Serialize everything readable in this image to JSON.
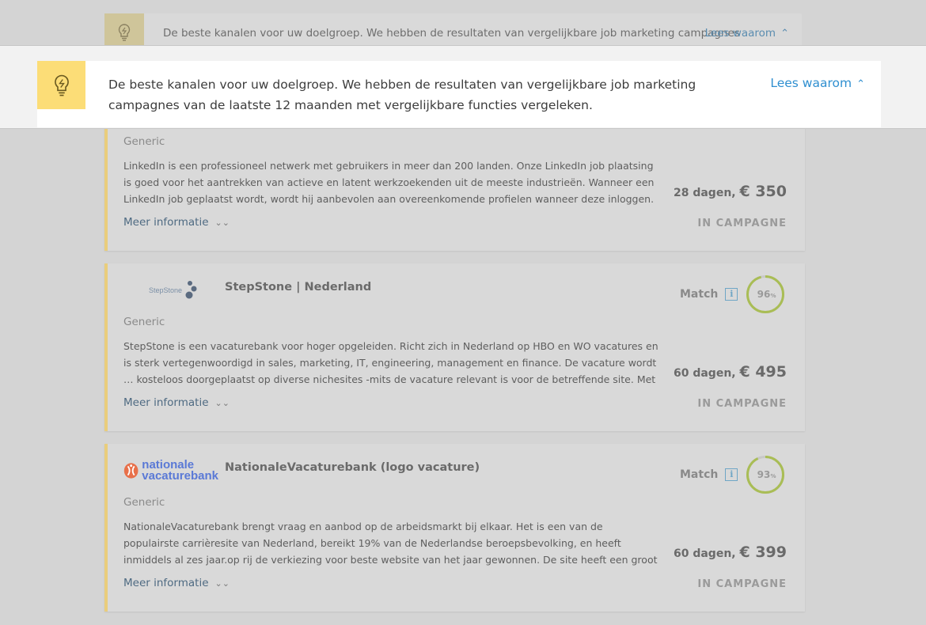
{
  "background_banner": {
    "text": "De beste kanalen voor uw doelgroep. We hebben de resultaten van vergelijkbare job marketing campagnes",
    "link": "Lees waarom"
  },
  "banner": {
    "text": "De beste kanalen voor uw doelgroep. We hebben de resultaten van vergelijkbare job marketing campagnes van de laatste 12 maanden met vergelijkbare functies vergeleken.",
    "link": "Lees waarom",
    "icon": "lightbulb-icon",
    "accent": "#fcdd77",
    "link_color": "#2f8fd0"
  },
  "cards": [
    {
      "category": "Generic",
      "description": "LinkedIn is een professioneel netwerk met gebruikers in meer dan 200 landen. Onze LinkedIn job plaatsing is goed voor het aantrekken van actieve en latent werkzoekenden uit de meeste industrieën. Wanneer een LinkedIn job geplaatst wordt, wordt hij aanbevolen aan overeenkomende profielen wanneer deze inloggen. Oo…",
      "duration": "28 dagen,",
      "price": "€ 350",
      "more": "Meer informatie",
      "status": "IN CAMPAGNE"
    },
    {
      "name": "StepStone | Nederland",
      "logo_text": "StepStone",
      "match_label": "Match",
      "info": "i",
      "match_value": "96",
      "match_unit": "%",
      "match_fraction": 0.96,
      "category": "Generic",
      "description": "StepStone is een vacaturebank voor hoger opgeleiden. Richt zich in Nederland op HBO en WO vacatures en is sterk vertegenwoordigd in sales, marketing, IT, engineering, management en finance. De vacature wordt          … kosteloos doorgeplaatst op diverse nichesites -mits de vacature relevant is voor de betreffende site. Met de",
      "duration": "60 dagen,",
      "price": "€ 495",
      "more": "Meer informatie",
      "status": "IN CAMPAGNE"
    },
    {
      "name": "NationaleVacaturebank (logo vacature)",
      "logo_line1": "nationale",
      "logo_line2": "vacaturebank",
      "match_label": "Match",
      "info": "i",
      "match_value": "93",
      "match_unit": "%",
      "match_fraction": 0.93,
      "category": "Generic",
      "description": "NationaleVacaturebank brengt vraag en aanbod op de arbeidsmarkt bij elkaar. Het is een van de populairste carrièresite van Nederland, bereikt 19% van de Nederlandse beroepsbevolking, en heeft inmiddels al zes jaar.op rij de verkiezing voor beste website van het jaar gewonnen. De site heeft een groot bereik in vrijwel iedere",
      "duration": "60 dagen,",
      "price": "€ 399",
      "more": "Meer informatie",
      "status": "IN CAMPAGNE"
    }
  ]
}
